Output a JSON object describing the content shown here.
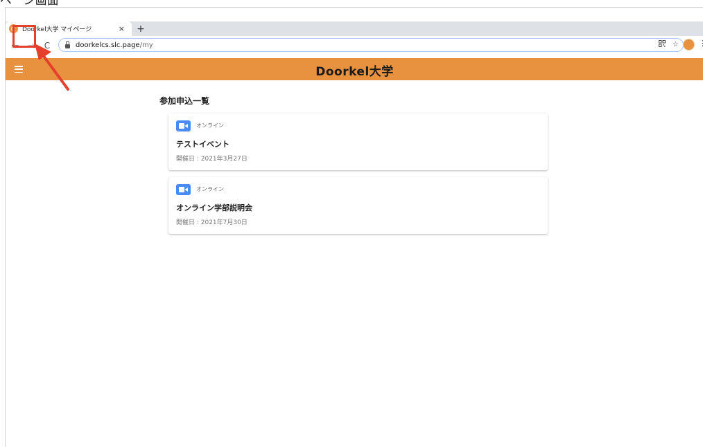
{
  "caption": "ページ画面",
  "browser": {
    "tab_title": "Doorkel大学 マイページ",
    "tab_close": "×",
    "new_tab": "+",
    "back": "←",
    "forward": "→",
    "reload": "C",
    "url_host": "doorkelcs.slc.page",
    "url_path": "/my",
    "qr_icon": "qr-code-icon",
    "star": "☆",
    "menu": "⋮"
  },
  "app": {
    "title": "Doorkel大学",
    "accent": "#e8913f"
  },
  "section_title": "参加申込一覧",
  "events": [
    {
      "type": "オンライン",
      "title": "テストイベント",
      "date": "開催日 : 2021年3月27日"
    },
    {
      "type": "オンライン",
      "title": "オンライン学部説明会",
      "date": "開催日 : 2021年7月30日"
    }
  ],
  "annotation_color": "#e5402b"
}
